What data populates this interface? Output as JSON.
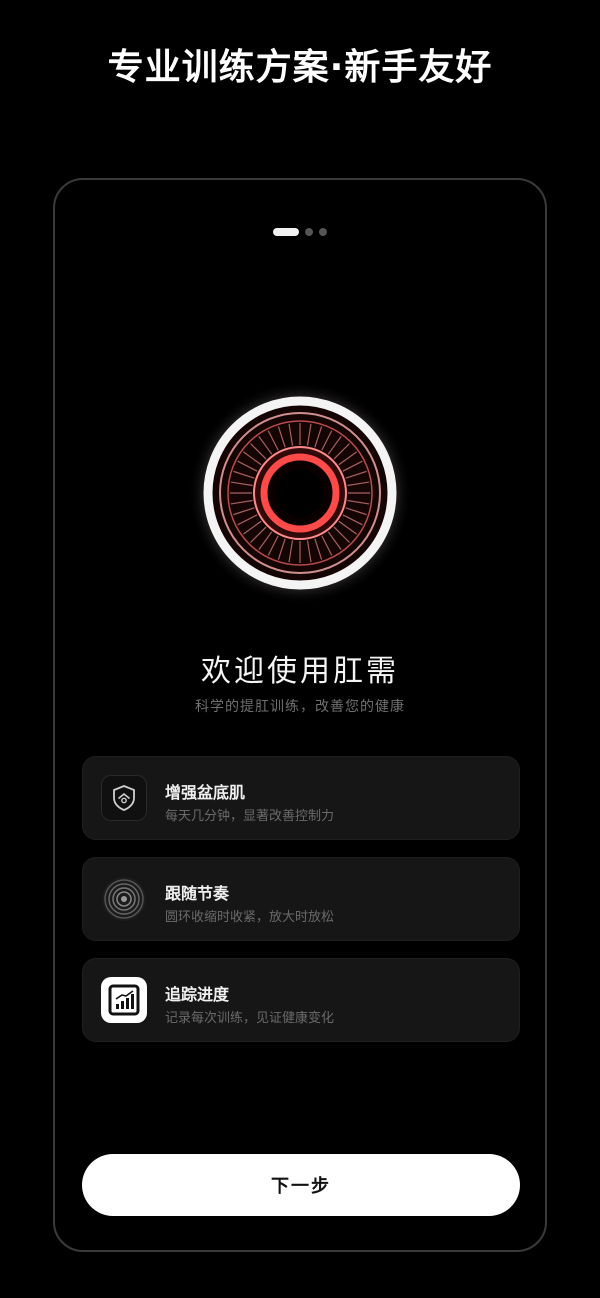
{
  "headline": "专业训练方案·新手友好",
  "pager": {
    "total": 3,
    "active_index": 0
  },
  "welcome": {
    "title": "欢迎使用肛需",
    "subtitle": "科学的提肛训练，改善您的健康"
  },
  "features": [
    {
      "icon": "shield-home-icon",
      "title": "增强盆底肌",
      "description": "每天几分钟，显著改善控制力"
    },
    {
      "icon": "concentric-rings-icon",
      "title": "跟随节奏",
      "description": "圆环收缩时收紧，放大时放松"
    },
    {
      "icon": "progress-chart-icon",
      "title": "追踪进度",
      "description": "记录每次训练，见证健康变化"
    }
  ],
  "next_button": {
    "label": "下一步"
  },
  "colors": {
    "background": "#000000",
    "ring_accent": "#ff4a4a",
    "card": "#161616",
    "button": "#ffffff"
  }
}
